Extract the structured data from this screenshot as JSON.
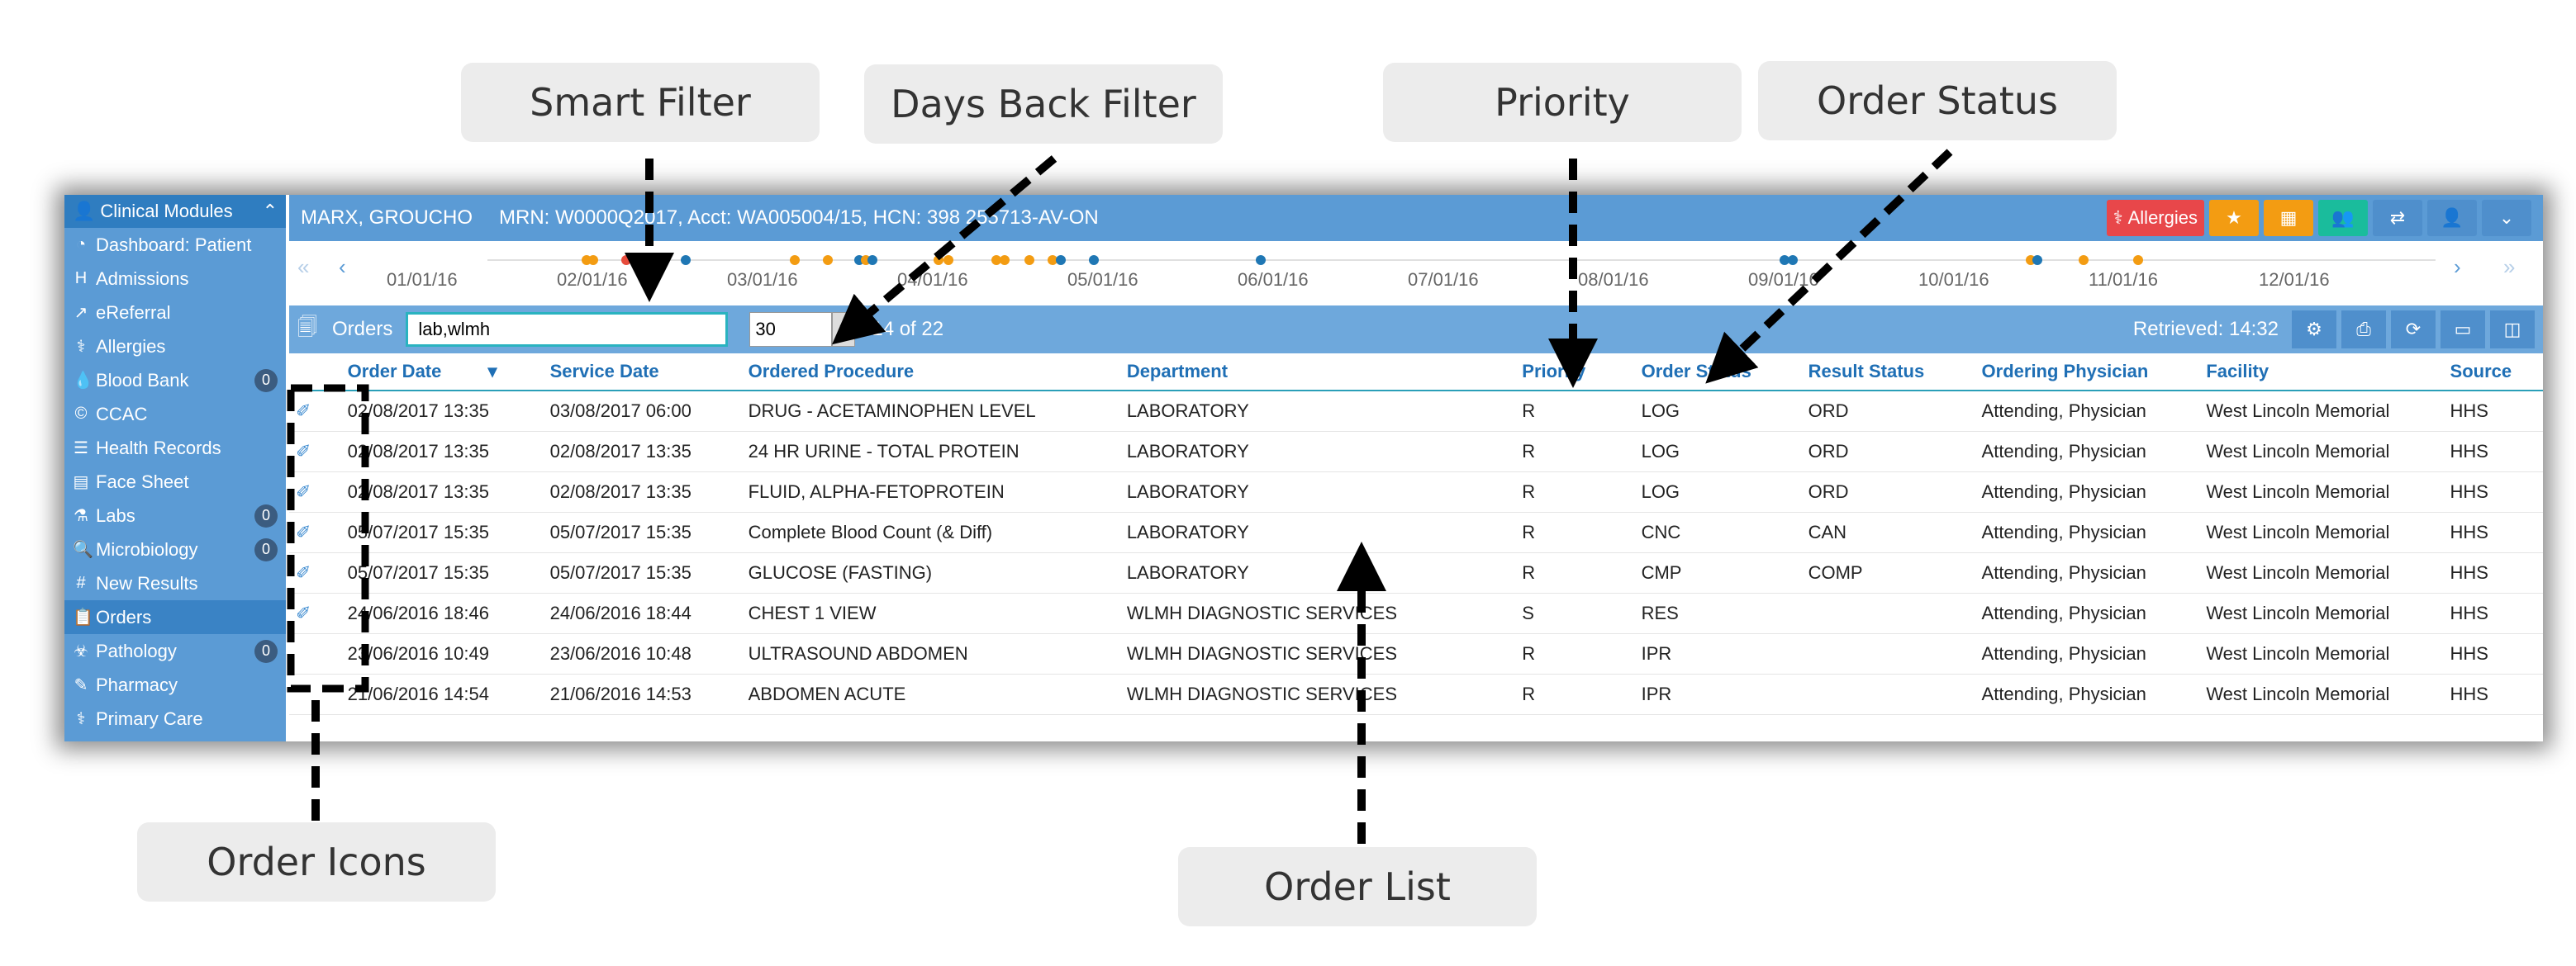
{
  "callouts": {
    "smart_filter": "Smart Filter",
    "days_back_filter": "Days Back Filter",
    "priority": "Priority",
    "order_status": "Order Status",
    "order_icons": "Order Icons",
    "order_list": "Order List"
  },
  "sidebar": {
    "header": "Clinical Modules",
    "items": [
      {
        "label": "Dashboard: Patient",
        "icon": "dashboard-icon"
      },
      {
        "label": "Admissions",
        "icon": "hospital-icon"
      },
      {
        "label": "eReferral",
        "icon": "referral-icon"
      },
      {
        "label": "Allergies",
        "icon": "allergy-icon"
      },
      {
        "label": "Blood Bank",
        "icon": "blood-icon",
        "badge": "0"
      },
      {
        "label": "CCAC",
        "icon": "ccac-icon"
      },
      {
        "label": "Health Records",
        "icon": "records-icon"
      },
      {
        "label": "Face Sheet",
        "icon": "document-icon"
      },
      {
        "label": "Labs",
        "icon": "flask-icon",
        "badge": "0"
      },
      {
        "label": "Microbiology",
        "icon": "microscope-icon",
        "badge": "0"
      },
      {
        "label": "New Results",
        "icon": "hash-icon"
      },
      {
        "label": "Orders",
        "icon": "clipboard-icon",
        "active": true
      },
      {
        "label": "Pathology",
        "icon": "biohazard-icon",
        "badge": "0"
      },
      {
        "label": "Pharmacy",
        "icon": "pharmacy-icon"
      },
      {
        "label": "Primary Care",
        "icon": "primary-care-icon"
      }
    ]
  },
  "patient": {
    "name": "MARX, GROUCHO",
    "ids": "MRN: W0000Q2017, Acct: WA005004/15, HCN: 398 255713-AV-ON",
    "allergies_label": "Allergies"
  },
  "timeline": {
    "dates": [
      "01/01/16",
      "02/01/16",
      "03/01/16",
      "04/01/16",
      "05/01/16",
      "06/01/16",
      "07/01/16",
      "08/01/16",
      "09/01/16",
      "10/01/16",
      "11/01/16",
      "12/01/16"
    ],
    "colors": {
      "orange": "#f39c12",
      "blue": "#1f77b4",
      "red": "#e74c3c"
    }
  },
  "orders_bar": {
    "label": "Orders",
    "filter_value": "lab,wlmh",
    "days_value": "30",
    "count_text": "14 of 22",
    "retrieved_text": "Retrieved: 14:32"
  },
  "table": {
    "headers": [
      "Order Date",
      "Service Date",
      "Ordered Procedure",
      "Department",
      "Priority",
      "Order Status",
      "Result Status",
      "Ordering Physician",
      "Facility",
      "Source"
    ],
    "rows": [
      [
        "02/08/2017 13:35",
        "03/08/2017 06:00",
        "DRUG - ACETAMINOPHEN LEVEL",
        "LABORATORY",
        "R",
        "LOG",
        "ORD",
        "Attending, Physician",
        "West Lincoln Memorial",
        "HHS"
      ],
      [
        "02/08/2017 13:35",
        "02/08/2017 13:35",
        "24 HR URINE - TOTAL PROTEIN",
        "LABORATORY",
        "R",
        "LOG",
        "ORD",
        "Attending, Physician",
        "West Lincoln Memorial",
        "HHS"
      ],
      [
        "02/08/2017 13:35",
        "02/08/2017 13:35",
        "FLUID, ALPHA-FETOPROTEIN",
        "LABORATORY",
        "R",
        "LOG",
        "ORD",
        "Attending, Physician",
        "West Lincoln Memorial",
        "HHS"
      ],
      [
        "05/07/2017 15:35",
        "05/07/2017 15:35",
        "Complete Blood Count (& Diff)",
        "LABORATORY",
        "R",
        "CNC",
        "CAN",
        "Attending, Physician",
        "West Lincoln Memorial",
        "HHS"
      ],
      [
        "05/07/2017 15:35",
        "05/07/2017 15:35",
        "GLUCOSE (FASTING)",
        "LABORATORY",
        "R",
        "CMP",
        "COMP",
        "Attending, Physician",
        "West Lincoln Memorial",
        "HHS"
      ],
      [
        "24/06/2016 18:46",
        "24/06/2016 18:44",
        "CHEST 1 VIEW",
        "WLMH DIAGNOSTIC SERVICES",
        "S",
        "RES",
        "",
        "Attending, Physician",
        "West Lincoln Memorial",
        "HHS"
      ],
      [
        "23/06/2016 10:49",
        "23/06/2016 10:48",
        "ULTRASOUND ABDOMEN",
        "WLMH DIAGNOSTIC SERVICES",
        "R",
        "IPR",
        "",
        "Attending, Physician",
        "West Lincoln Memorial",
        "HHS"
      ],
      [
        "21/06/2016 14:54",
        "21/06/2016 14:53",
        "ABDOMEN ACUTE",
        "WLMH DIAGNOSTIC SERVICES",
        "R",
        "IPR",
        "",
        "Attending, Physician",
        "West Lincoln Memorial",
        "HHS"
      ]
    ],
    "icon_rows": 6
  }
}
